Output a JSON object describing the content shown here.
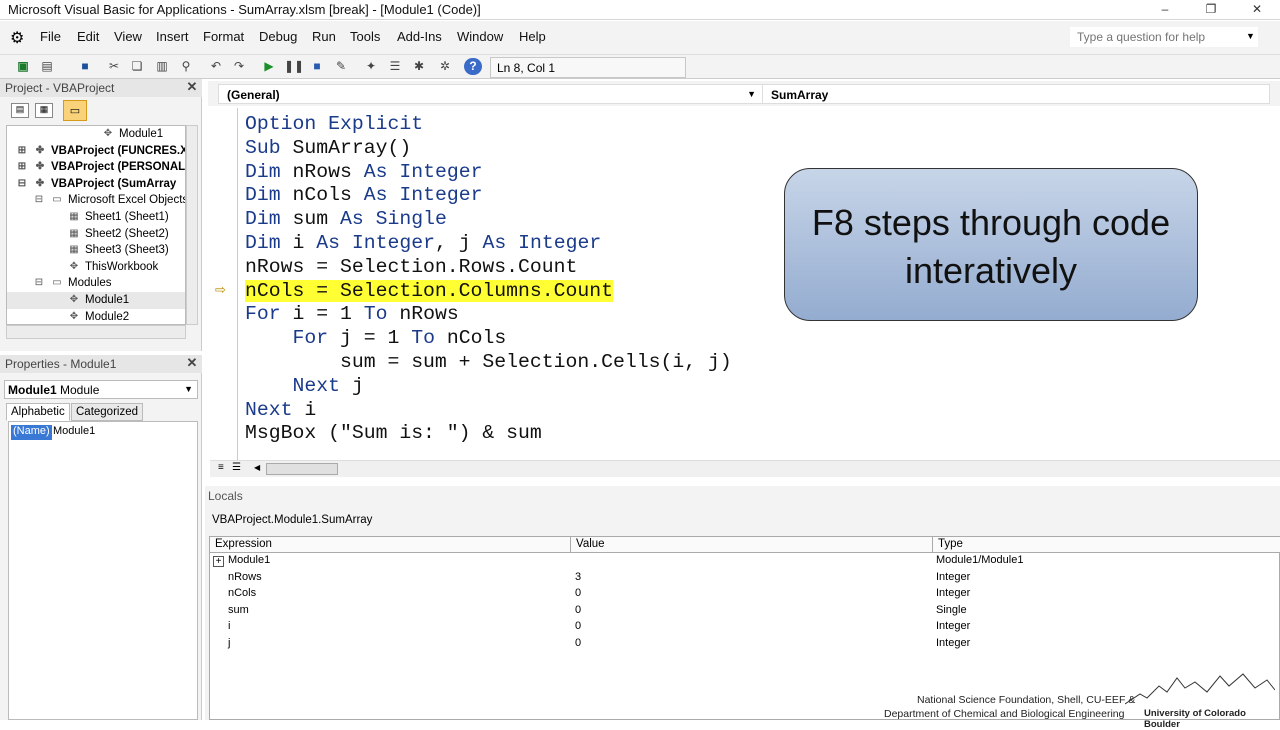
{
  "window": {
    "title": "Microsoft Visual Basic for Applications - SumArray.xlsm [break] - [Module1 (Code)]",
    "controls": [
      "–",
      "❐",
      "✕"
    ]
  },
  "menu": {
    "items": [
      "File",
      "Edit",
      "View",
      "Insert",
      "Format",
      "Debug",
      "Run",
      "Tools",
      "Add-Ins",
      "Window",
      "Help"
    ],
    "help_placeholder": "Type a question for help"
  },
  "toolbar": {
    "position": "Ln 8, Col 1",
    "icons": [
      "excel-icon",
      "insert-module-icon",
      "save-icon",
      "cut-icon",
      "copy-icon",
      "paste-icon",
      "find-icon",
      "undo-icon",
      "redo-icon",
      "run-icon",
      "break-icon",
      "reset-icon",
      "design-mode-icon",
      "project-explorer-icon",
      "properties-icon",
      "object-browser-icon",
      "toolbox-icon",
      "help-icon"
    ]
  },
  "project": {
    "header": "Project - VBAProject",
    "tree": [
      {
        "label": "Module1",
        "indent": 4,
        "icon": "module-icon",
        "bold": false
      },
      {
        "label": "VBAProject (FUNCRES.X",
        "indent": 0,
        "icon": "vbaproject-icon",
        "bold": true
      },
      {
        "label": "VBAProject (PERSONAL",
        "indent": 0,
        "icon": "vbaproject-icon",
        "bold": true
      },
      {
        "label": "VBAProject (SumArray",
        "indent": 0,
        "icon": "vbaproject-icon",
        "bold": true
      },
      {
        "label": "Microsoft Excel Objects",
        "indent": 1,
        "icon": "folder-icon",
        "bold": false
      },
      {
        "label": "Sheet1 (Sheet1)",
        "indent": 2,
        "icon": "sheet-icon",
        "bold": false
      },
      {
        "label": "Sheet2 (Sheet2)",
        "indent": 2,
        "icon": "sheet-icon",
        "bold": false
      },
      {
        "label": "Sheet3 (Sheet3)",
        "indent": 2,
        "icon": "sheet-icon",
        "bold": false
      },
      {
        "label": "ThisWorkbook",
        "indent": 2,
        "icon": "workbook-icon",
        "bold": false
      },
      {
        "label": "Modules",
        "indent": 1,
        "icon": "folder-icon",
        "bold": false
      },
      {
        "label": "Module1",
        "indent": 2,
        "icon": "module-icon",
        "bold": false
      },
      {
        "label": "Module2",
        "indent": 2,
        "icon": "module-icon",
        "bold": false
      }
    ]
  },
  "properties": {
    "header": "Properties - Module1",
    "selector_name": "Module1",
    "selector_type": "Module",
    "tabs": [
      "Alphabetic",
      "Categorized"
    ],
    "rows": [
      {
        "name": "(Name)",
        "value": "Module1"
      }
    ]
  },
  "code": {
    "object_dropdown": "(General)",
    "proc_dropdown": "SumArray",
    "lines": [
      "Option Explicit",
      "Sub SumArray()",
      "Dim nRows As Integer",
      "Dim nCols As Integer",
      "Dim sum As Single",
      "Dim i As Integer, j As Integer",
      "nRows = Selection.Rows.Count",
      "nCols = Selection.Columns.Count",
      "For i = 1 To nRows",
      "    For j = 1 To nCols",
      "        sum = sum + Selection.Cells(i, j)",
      "    Next j",
      "Next i",
      "MsgBox (\"Sum is: \") & sum"
    ],
    "current_line": 8,
    "callout": "F8 steps through code interatively"
  },
  "locals": {
    "header": "Locals",
    "context": "VBAProject.Module1.SumArray",
    "columns": [
      "Expression",
      "Value",
      "Type"
    ],
    "rows": [
      {
        "expr": "Module1",
        "value": "",
        "type": "Module1/Module1",
        "expandable": true
      },
      {
        "expr": "nRows",
        "value": "3",
        "type": "Integer",
        "expandable": false
      },
      {
        "expr": "nCols",
        "value": "0",
        "type": "Integer",
        "expandable": false
      },
      {
        "expr": "sum",
        "value": "0",
        "type": "Single",
        "expandable": false
      },
      {
        "expr": "i",
        "value": "0",
        "type": "Integer",
        "expandable": false
      },
      {
        "expr": "j",
        "value": "0",
        "type": "Integer",
        "expandable": false
      }
    ]
  },
  "footer": {
    "credit1": "National Science Foundation, Shell, CU-EEF &",
    "credit2": "Department of Chemical and Biological Engineering",
    "university": "University of Colorado Boulder"
  },
  "colors": {
    "highlight": "#ffff33",
    "keyword": "#1a3a8a",
    "callout": "#94acd0"
  }
}
